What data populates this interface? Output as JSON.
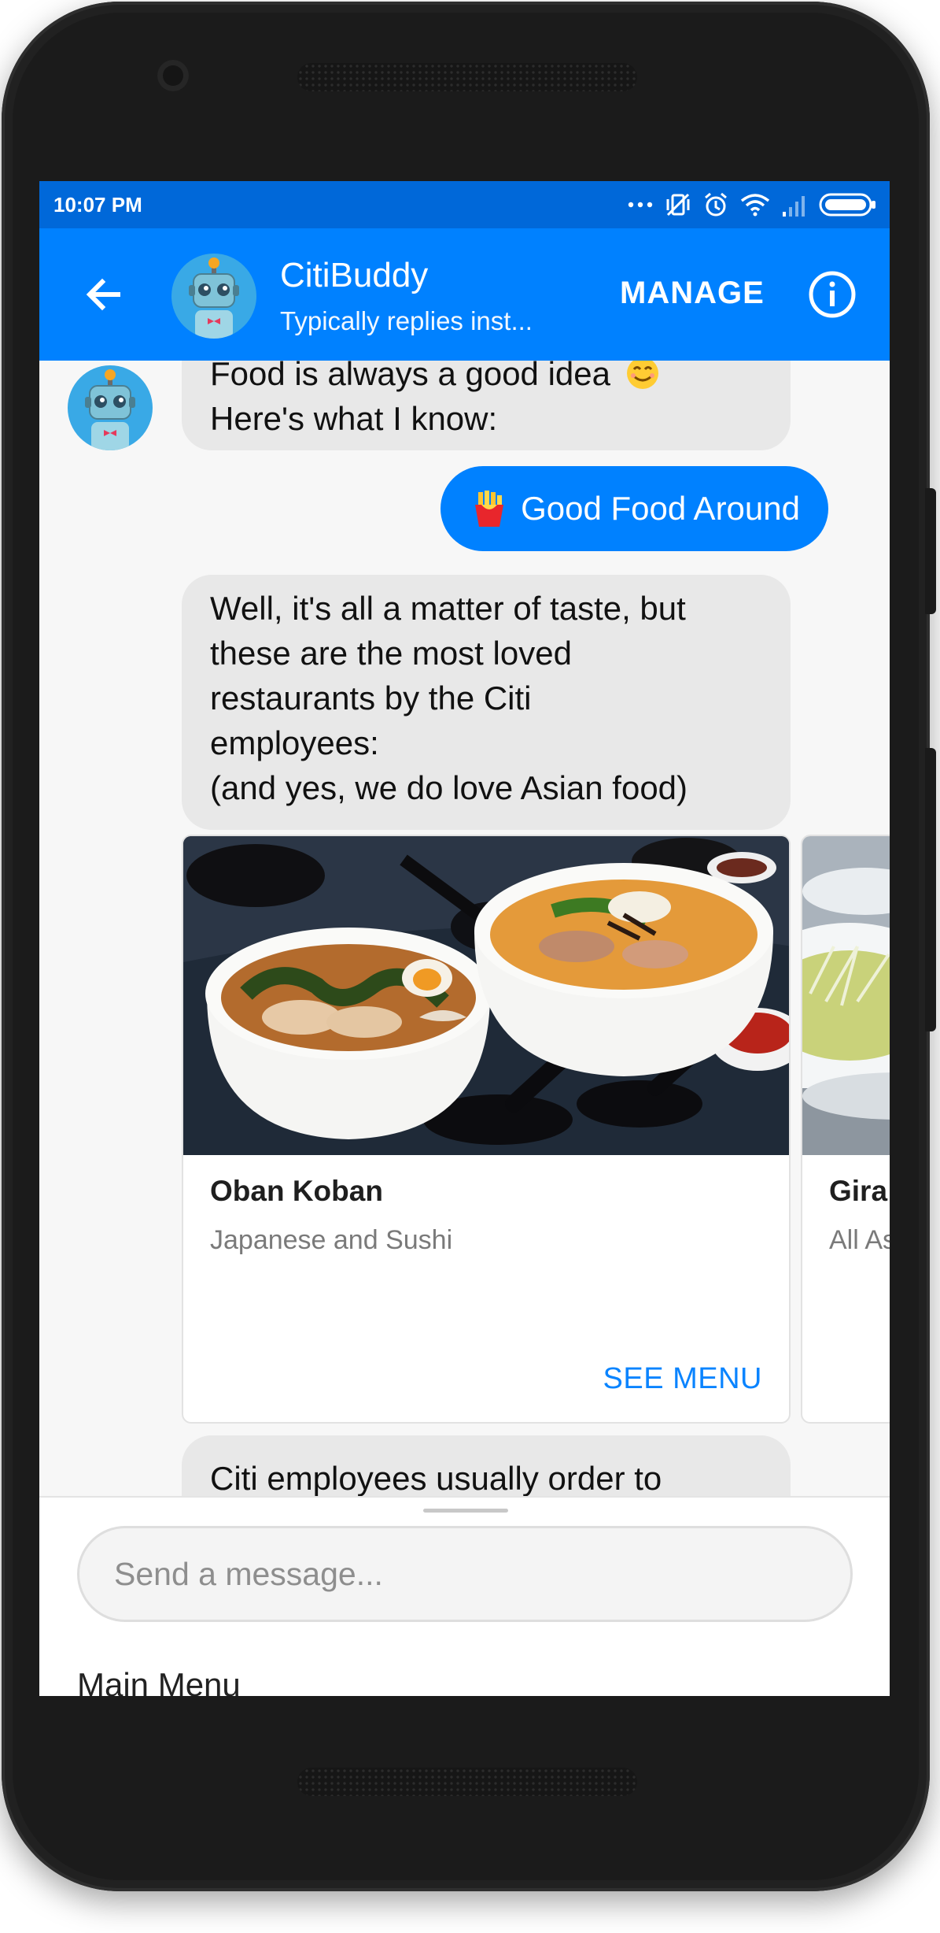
{
  "status_bar": {
    "time": "10:07 PM",
    "icons": [
      "more-dots-icon",
      "vibrate-off-icon",
      "alarm-icon",
      "wifi-icon",
      "signal-icon",
      "battery-icon"
    ]
  },
  "app_bar": {
    "back_icon": "arrow-left-icon",
    "bot_name": "CitiBuddy",
    "bot_status": "Typically replies inst...",
    "manage_label": "MANAGE",
    "info_icon": "info-icon",
    "color": "#0081ff",
    "status_color": "#0068d9"
  },
  "messages": {
    "first_bubble": {
      "line1": "Food is always a good idea",
      "line1_emoji": "smiling-face-icon",
      "line2": "Here's what I know:"
    },
    "user_reply": {
      "emoji": "fries-icon",
      "text": "Good Food Around"
    },
    "second_bubble": {
      "lines": [
        "Well, it's all a matter of taste, but",
        "these are the most loved",
        "restaurants by the Citi",
        "employees:",
        "(and yes, we do love Asian food)"
      ]
    },
    "cards": [
      {
        "title": "Oban Koban",
        "subtitle": "Japanese and Sushi",
        "button": "SEE MENU"
      },
      {
        "title": "Gira",
        "subtitle": "All As",
        "button": ""
      }
    ],
    "third_bubble": {
      "text": "Citi employees usually order to"
    }
  },
  "composer": {
    "placeholder": "Send a message...",
    "menu_label": "Main Menu"
  },
  "colors": {
    "incoming_bubble": "#e8e8e8",
    "outgoing_bubble": "#0081ff",
    "link": "#0a84ff"
  }
}
